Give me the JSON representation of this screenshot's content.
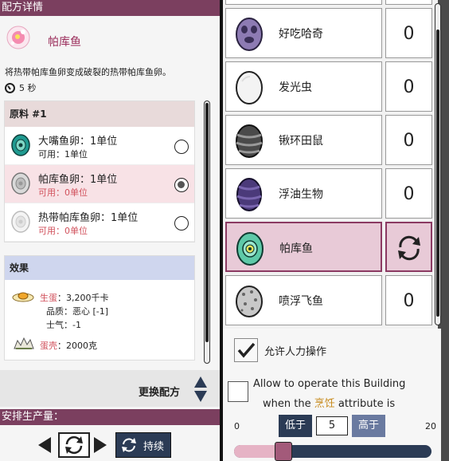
{
  "left": {
    "header": "配方详情",
    "recipe": {
      "name": "帕库鱼",
      "description": "将热带帕库鱼卵变成破裂的热带帕库鱼卵。",
      "time": "5 秒"
    },
    "ingredients": {
      "title": "原料 #1",
      "items": [
        {
          "name": "大嘴鱼卵：1单位",
          "available": "可用：1单位",
          "available_ok": true,
          "selected": false,
          "icon": "teal-egg-icon"
        },
        {
          "name": "帕库鱼卵：1单位",
          "available": "可用：0单位",
          "available_ok": false,
          "selected": true,
          "icon": "grey-egg-icon"
        },
        {
          "name": "热带帕库鱼卵：1单位",
          "available": "可用：0单位",
          "available_ok": false,
          "selected": false,
          "icon": "white-egg-icon"
        }
      ]
    },
    "effects": {
      "title": "效果",
      "yolk_label": "生蛋",
      "yolk_value": "：3,200千卡",
      "quality": "品质：恶心 [-1]",
      "morale": "士气：-1",
      "shell_label": "蛋壳",
      "shell_value": "：2000克"
    },
    "change_recipe": "更换配方",
    "production_header": "安排生产量：",
    "continuous_label": "持续"
  },
  "right": {
    "critters": [
      {
        "name": "好吃哈奇",
        "count": "0",
        "icon": "purple-spotted-egg-icon",
        "selected": false
      },
      {
        "name": "发光虫",
        "count": "0",
        "icon": "white-egg-icon",
        "selected": false
      },
      {
        "name": "锹环田鼠",
        "count": "0",
        "icon": "striped-egg-icon",
        "selected": false
      },
      {
        "name": "浮油生物",
        "count": "0",
        "icon": "purple-striped-egg-icon",
        "selected": false
      },
      {
        "name": "帕库鱼",
        "count": "",
        "icon": "teal-fish-egg-icon",
        "selected": true
      },
      {
        "name": "喷浮飞鱼",
        "count": "0",
        "icon": "dotted-egg-icon",
        "selected": false
      }
    ],
    "manual_operation": "允许人力操作",
    "allow_line1": "Allow to operate this Building",
    "allow_line2_pre": "when the ",
    "allow_line2_hl": "烹饪",
    "allow_line2_post": " attribute is",
    "range_min": "0",
    "range_max": "20",
    "below_label": "低于",
    "above_label": "高于",
    "threshold_value": "5",
    "threshold_fraction": 0.25
  },
  "colors": {
    "header_bg": "#7b3f5f",
    "accent_pink": "#e8cad7",
    "button_navy": "#2b3b55",
    "warning_red": "#d1515c",
    "highlight_gold": "#c7891a"
  }
}
